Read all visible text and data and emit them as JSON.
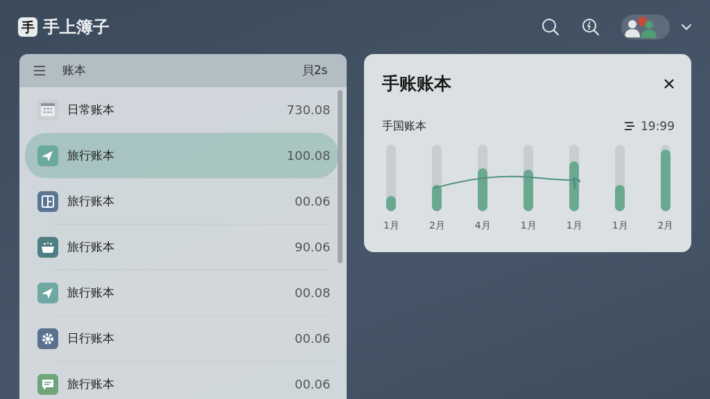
{
  "app": {
    "logo_char": "手",
    "title": "手上簿子"
  },
  "list_panel": {
    "title": "账本",
    "badge": "貝2s",
    "rows": [
      {
        "name": "日常账本",
        "amount": "730.08",
        "selected": false,
        "kind": "calendar",
        "color": "#c9ced3"
      },
      {
        "name": "旅行账本",
        "amount": "100.08",
        "selected": true,
        "kind": "plane",
        "color": "#6aa9a0"
      },
      {
        "name": "旅行账本",
        "amount": "00.06",
        "selected": false,
        "kind": "book",
        "color": "#5b7595"
      },
      {
        "name": "旅行账本",
        "amount": "90.06",
        "selected": false,
        "kind": "basket",
        "color": "#4f7f82"
      },
      {
        "name": "旅行账本",
        "amount": "00.08",
        "selected": false,
        "kind": "plane",
        "color": "#6fa7a3"
      },
      {
        "name": "日行账本",
        "amount": "00.06",
        "selected": false,
        "kind": "gear",
        "color": "#5a7190"
      },
      {
        "name": "旅行账本",
        "amount": "00.06",
        "selected": false,
        "kind": "chat",
        "color": "#6ea57a"
      }
    ]
  },
  "detail_card": {
    "title": "手账账本",
    "subtitle": "手国账本",
    "reading": "19:99",
    "bars": [
      {
        "label": "1月",
        "level": 0.23
      },
      {
        "label": "2月",
        "level": 0.4
      },
      {
        "label": "4月",
        "level": 0.65
      },
      {
        "label": "1月",
        "level": 0.63
      },
      {
        "label": "1月",
        "level": 0.75
      },
      {
        "label": "1月",
        "level": 0.4
      },
      {
        "label": "2月",
        "level": 0.93
      }
    ]
  }
}
